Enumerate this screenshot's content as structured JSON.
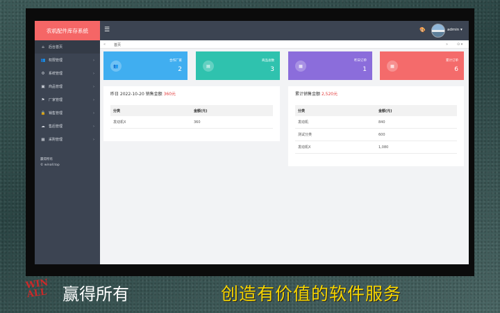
{
  "app": {
    "title": "农机配件库存系统"
  },
  "sidebar": {
    "items": [
      {
        "icon": "home-icon",
        "glyph": "⌂",
        "label": "后台首页",
        "active": true
      },
      {
        "icon": "users-icon",
        "glyph": "👥",
        "label": "权限管理"
      },
      {
        "icon": "gear-icon",
        "glyph": "⚙",
        "label": "系统管理"
      },
      {
        "icon": "box-icon",
        "glyph": "▣",
        "label": "商品管理"
      },
      {
        "icon": "factory-icon",
        "glyph": "⚑",
        "label": "厂家管理"
      },
      {
        "icon": "lock-icon",
        "glyph": "🔒",
        "label": "销售管理"
      },
      {
        "icon": "cloud-icon",
        "glyph": "☁",
        "label": "售后管理"
      },
      {
        "icon": "grid-icon",
        "glyph": "▦",
        "label": "采购管理"
      }
    ],
    "footer": {
      "line1": "赢得所有",
      "line2": "© winall.top"
    }
  },
  "topbar": {
    "user": "admin ▾"
  },
  "breadcrumb": {
    "current": "首页"
  },
  "cards": [
    {
      "label": "合作厂家",
      "value": "2",
      "color": "#40aef0",
      "icon": "users-icon",
      "glyph": "👥"
    },
    {
      "label": "商品总数",
      "value": "3",
      "color": "#2fc2ae",
      "icon": "bag-icon",
      "glyph": "▤"
    },
    {
      "label": "昨日订单",
      "value": "1",
      "color": "#8b6ddb",
      "icon": "grid-icon",
      "glyph": "▦"
    },
    {
      "label": "累计订单",
      "value": "6",
      "color": "#f46b6b",
      "icon": "grid-icon",
      "glyph": "▦"
    }
  ],
  "panel_yesterday": {
    "title_prefix": "昨日 2022-10-20 销售金额",
    "amount": "360元",
    "headers": [
      "分类",
      "金额(元)"
    ],
    "rows": [
      [
        "发动机X",
        "360"
      ]
    ]
  },
  "panel_total": {
    "title_prefix": "累计销售金额",
    "amount": "2,520元",
    "headers": [
      "分类",
      "金额(元)"
    ],
    "rows": [
      [
        "发动机",
        "840"
      ],
      [
        "测试分类",
        "600"
      ],
      [
        "发动机X",
        "1,080"
      ]
    ]
  },
  "banner": {
    "logo_lines": [
      "WIN",
      "ALL"
    ],
    "company": "赢得所有",
    "slogan": "创造有价值的软件服务"
  }
}
